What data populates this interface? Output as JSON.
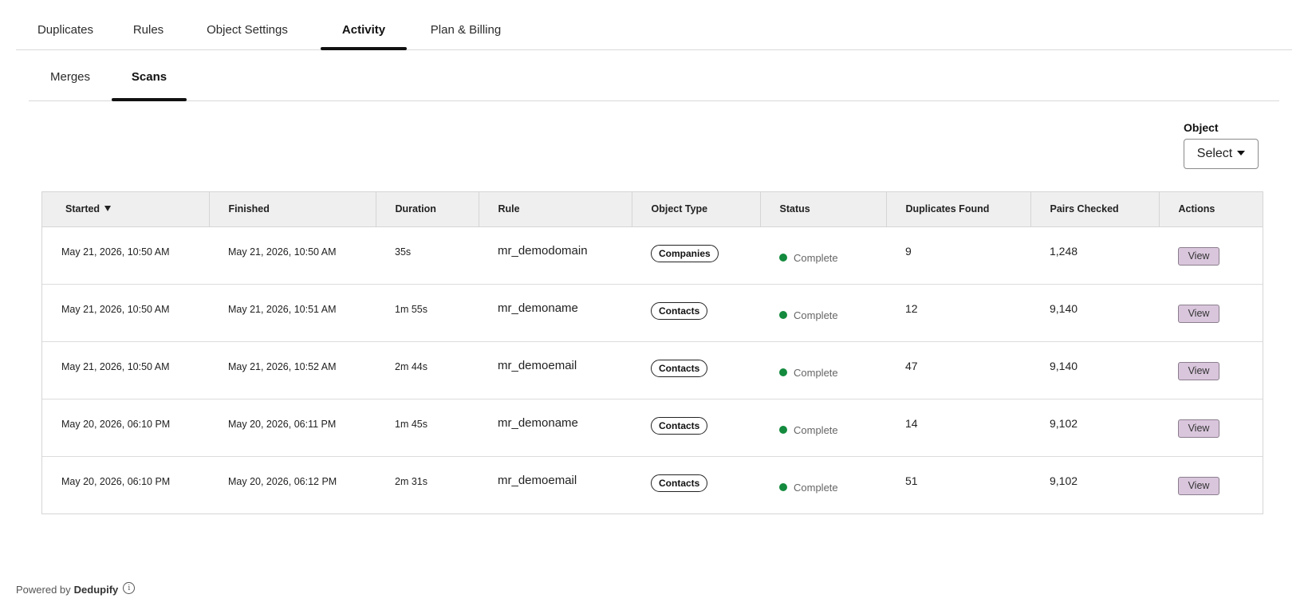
{
  "top_tabs": [
    {
      "label": "Duplicates",
      "active": false
    },
    {
      "label": "Rules",
      "active": false
    },
    {
      "label": "Object Settings",
      "active": false
    },
    {
      "label": "Activity",
      "active": true
    },
    {
      "label": "Plan & Billing",
      "active": false
    }
  ],
  "sub_tabs": [
    {
      "label": "Merges",
      "active": false
    },
    {
      "label": "Scans",
      "active": true
    }
  ],
  "filter": {
    "label": "Object",
    "select_value": "Select"
  },
  "table": {
    "columns": [
      "Started",
      "Finished",
      "Duration",
      "Rule",
      "Object Type",
      "Status",
      "Duplicates Found",
      "Pairs Checked",
      "Actions"
    ],
    "sort_column": "Started",
    "sort_direction": "descending",
    "rows": [
      {
        "started": "May 21, 2026, 10:50 AM",
        "finished": "May 21, 2026, 10:50 AM",
        "duration": "35s",
        "rule": "mr_demodomain",
        "object_type": "Companies",
        "status": "Complete",
        "duplicates_found": "9",
        "pairs_checked": "1,248",
        "action": "View"
      },
      {
        "started": "May 21, 2026, 10:50 AM",
        "finished": "May 21, 2026, 10:51 AM",
        "duration": "1m 55s",
        "rule": "mr_demoname",
        "object_type": "Contacts",
        "status": "Complete",
        "duplicates_found": "12",
        "pairs_checked": "9,140",
        "action": "View"
      },
      {
        "started": "May 21, 2026, 10:50 AM",
        "finished": "May 21, 2026, 10:52 AM",
        "duration": "2m 44s",
        "rule": "mr_demoemail",
        "object_type": "Contacts",
        "status": "Complete",
        "duplicates_found": "47",
        "pairs_checked": "9,140",
        "action": "View"
      },
      {
        "started": "May 20, 2026, 06:10 PM",
        "finished": "May 20, 2026, 06:11 PM",
        "duration": "1m 45s",
        "rule": "mr_demoname",
        "object_type": "Contacts",
        "status": "Complete",
        "duplicates_found": "14",
        "pairs_checked": "9,102",
        "action": "View"
      },
      {
        "started": "May 20, 2026, 06:10 PM",
        "finished": "May 20, 2026, 06:12 PM",
        "duration": "2m 31s",
        "rule": "mr_demoemail",
        "object_type": "Contacts",
        "status": "Complete",
        "duplicates_found": "51",
        "pairs_checked": "9,102",
        "action": "View"
      }
    ]
  },
  "footer": {
    "powered_by": "Powered by",
    "brand": "Dedupify",
    "info_icon": "info-icon"
  },
  "colors": {
    "status_complete": "#138a3d",
    "view_button_bg": "#d9c6dc",
    "header_bg": "#efefef"
  }
}
